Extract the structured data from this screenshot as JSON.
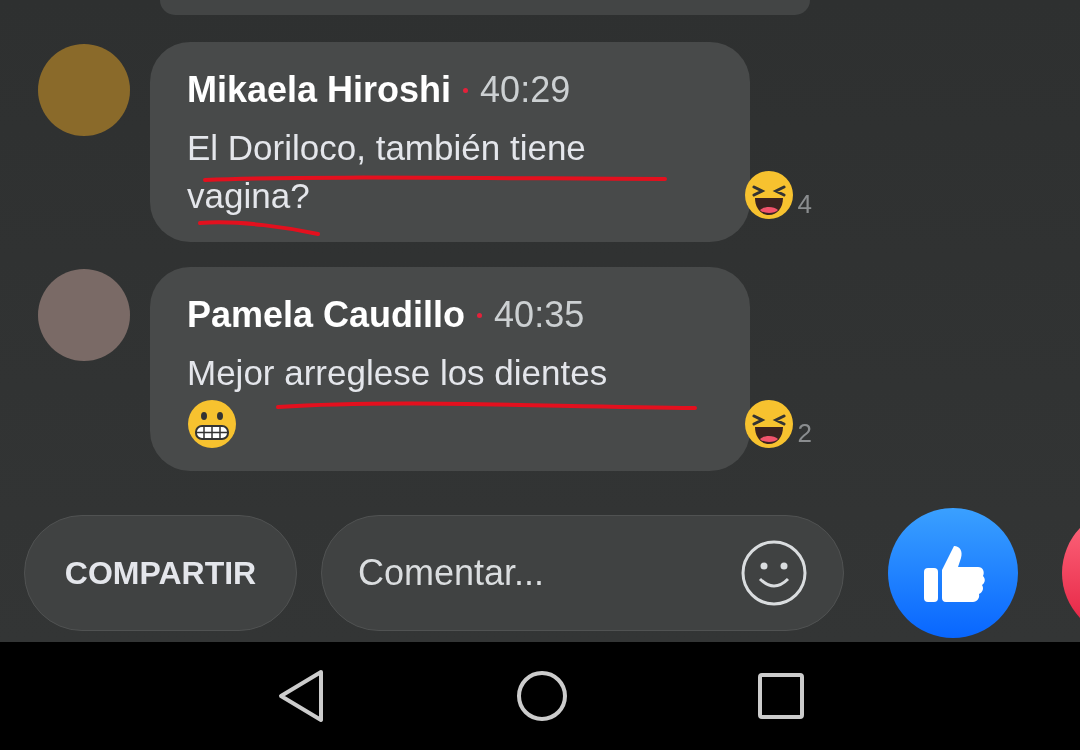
{
  "comments": [
    {
      "author": "Mikaela Hiroshi",
      "time": "40:29",
      "text": "El Doriloco, también tiene vagina?",
      "underlined": true,
      "reaction": {
        "kind": "haha",
        "count": "4"
      }
    },
    {
      "author": "Pamela Caudillo",
      "time": "40:35",
      "text": "Mejor arreglese los dientes",
      "trailing_emoji": {
        "kind": "grimace"
      },
      "underlined": true,
      "reaction": {
        "kind": "haha",
        "count": "2"
      }
    }
  ],
  "bottom_bar": {
    "share_button": "COMPARTIR",
    "comment_field": {
      "placeholder": "Comentar..."
    }
  }
}
